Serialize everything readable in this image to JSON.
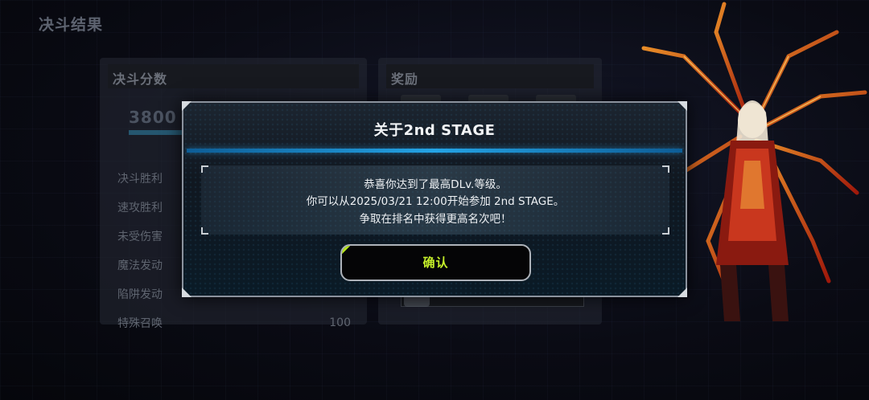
{
  "background": {
    "page_title": "决斗结果",
    "score_panel": {
      "header": "决斗分数",
      "score": "3800",
      "rows": [
        {
          "label": "决斗胜利",
          "value": ""
        },
        {
          "label": "速攻胜利",
          "value": ""
        },
        {
          "label": "未受伤害",
          "value": ""
        },
        {
          "label": "魔法发动",
          "value": ""
        },
        {
          "label": "陷阱发动",
          "value": ""
        },
        {
          "label": "特殊召唤",
          "value": "100"
        }
      ]
    },
    "reward_panel": {
      "header": "奖励"
    }
  },
  "dialog": {
    "title": "关于2nd STAGE",
    "message_lines": [
      "恭喜你达到了最高DLv.等级。",
      "你可以从2025/03/21 12:00开始参加 2nd STAGE。",
      "争取在排名中获得更高名次吧！"
    ],
    "confirm_label": "确认"
  },
  "colors": {
    "accent_blue": "#24a4e6",
    "confirm_text": "#c5ef2a",
    "dialog_border": "#8b929d"
  }
}
